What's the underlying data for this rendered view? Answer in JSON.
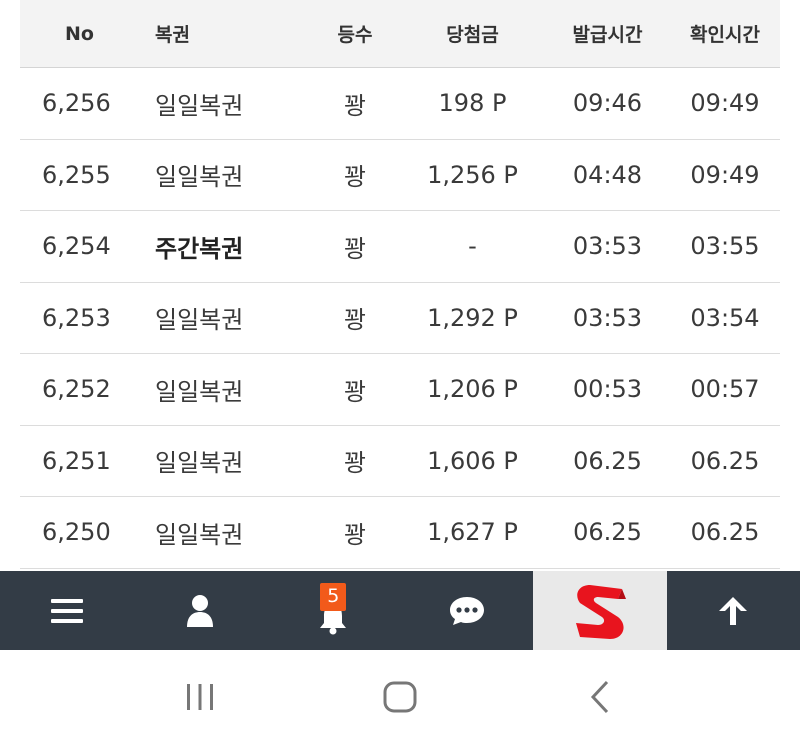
{
  "table": {
    "headers": [
      "No",
      "복권",
      "등수",
      "당첨금",
      "발급시간",
      "확인시간"
    ],
    "rows": [
      {
        "no": "6,256",
        "type": "일일복권",
        "rank": "꽝",
        "prize": "198 P",
        "issued": "09:46",
        "checked": "09:49",
        "bold": false
      },
      {
        "no": "6,255",
        "type": "일일복권",
        "rank": "꽝",
        "prize": "1,256 P",
        "issued": "04:48",
        "checked": "09:49",
        "bold": false
      },
      {
        "no": "6,254",
        "type": "주간복권",
        "rank": "꽝",
        "prize": "-",
        "issued": "03:53",
        "checked": "03:55",
        "bold": true
      },
      {
        "no": "6,253",
        "type": "일일복권",
        "rank": "꽝",
        "prize": "1,292 P",
        "issued": "03:53",
        "checked": "03:54",
        "bold": false
      },
      {
        "no": "6,252",
        "type": "일일복권",
        "rank": "꽝",
        "prize": "1,206 P",
        "issued": "00:53",
        "checked": "00:57",
        "bold": false
      },
      {
        "no": "6,251",
        "type": "일일복권",
        "rank": "꽝",
        "prize": "1,606 P",
        "issued": "06.25",
        "checked": "06.25",
        "bold": false
      },
      {
        "no": "6,250",
        "type": "일일복권",
        "rank": "꽝",
        "prize": "1,627 P",
        "issued": "06.25",
        "checked": "06.25",
        "bold": false
      }
    ]
  },
  "bottom_bar": {
    "notification_count": "5",
    "icons": [
      "menu-icon",
      "user-icon",
      "bell-icon",
      "chat-icon",
      "logo",
      "arrow-up-icon"
    ],
    "bar_color": "#333c46",
    "badge_color": "#f25a1a",
    "logo_color": "#e8141e"
  },
  "system_nav": {
    "icons": [
      "recent-apps-icon",
      "home-icon",
      "back-icon"
    ]
  }
}
